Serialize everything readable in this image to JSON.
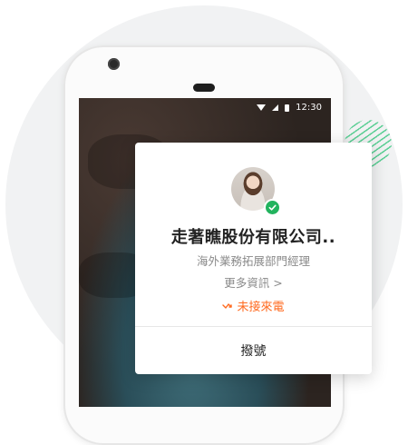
{
  "status_bar": {
    "time": "12:30",
    "icons": [
      "wifi-icon",
      "signal-icon",
      "battery-icon"
    ]
  },
  "caller_card": {
    "avatar": "caller-avatar",
    "verified_icon": "check-icon",
    "company": "走著瞧股份有限公司..",
    "position": "海外業務拓展部門經理",
    "more_info": "更多資訊 >",
    "missed_call": "未接來電",
    "missed_icon": "missed-call-icon",
    "dial_button": "撥號"
  },
  "colors": {
    "accent_orange": "#ff6a1f",
    "online_green": "#22b35e",
    "decor_green": "#5ccf95"
  }
}
